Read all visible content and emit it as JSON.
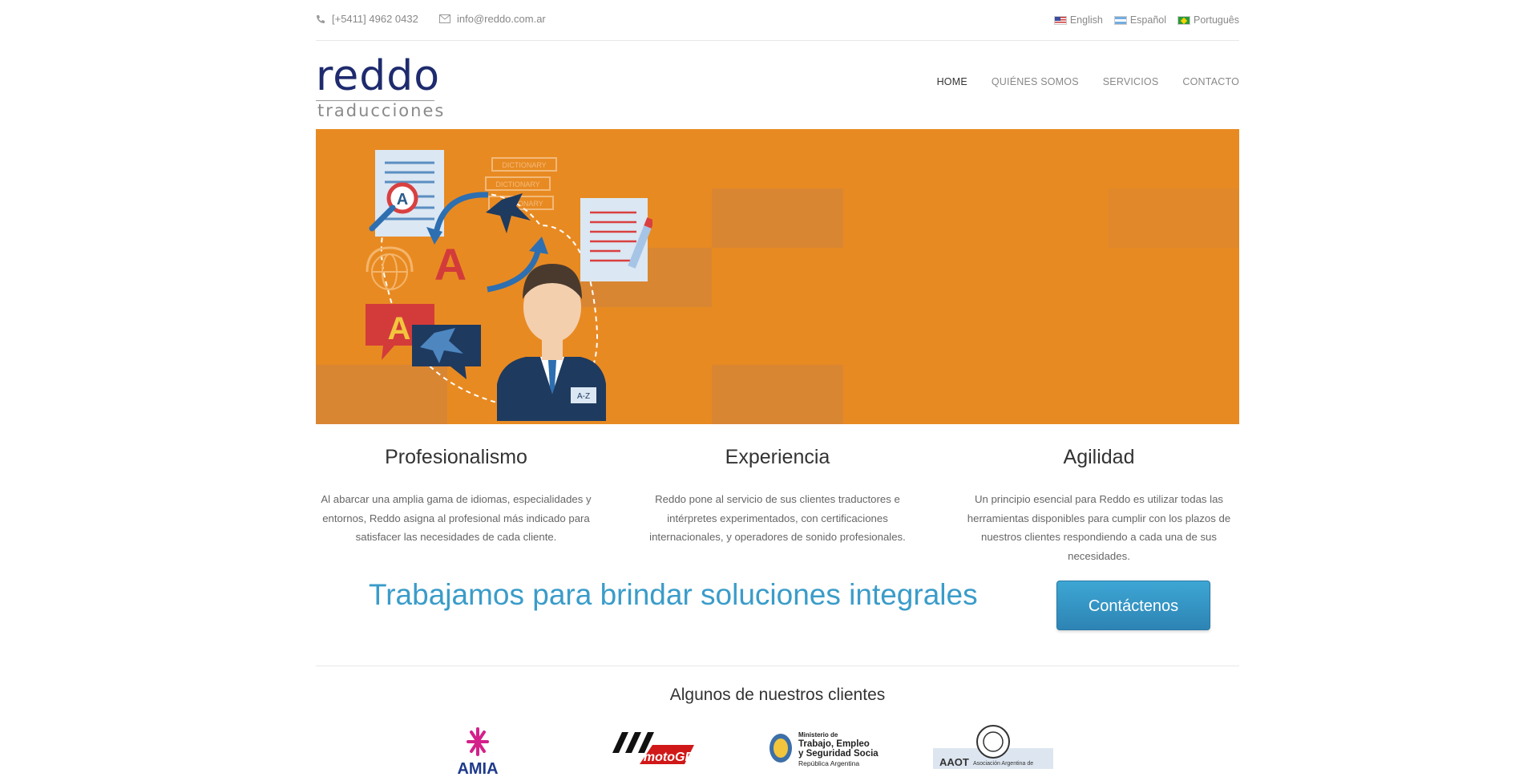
{
  "topbar": {
    "phone": "[+5411] 4962 0432",
    "email": "info@reddo.com.ar",
    "phone_icon": "phone-icon",
    "email_icon": "envelope-icon",
    "languages": [
      {
        "label": "English",
        "flag": "us-flag-icon"
      },
      {
        "label": "Español",
        "flag": "argentina-flag-icon"
      },
      {
        "label": "Português",
        "flag": "brazil-flag-icon"
      }
    ]
  },
  "logo": {
    "top": "reddo",
    "bottom": "traducciones"
  },
  "nav": {
    "items": [
      "HOME",
      "QUIÉNES SOMOS",
      "SERVICIOS",
      "CONTACTO"
    ],
    "active": "HOME"
  },
  "banner": {
    "background": "#e88a22",
    "doc_letter": "A",
    "bubble_letter": "A",
    "big_letter": "A",
    "badge": "A-Z",
    "dictionary_label": "DICTIONARY"
  },
  "features": [
    {
      "title": "Profesionalismo",
      "text": "Al abarcar una amplia gama de idiomas, especialidades y entornos, Reddo asigna al profesional más indicado para satisfacer las necesidades de cada cliente."
    },
    {
      "title": "Experiencia",
      "text": "Reddo pone al servicio de sus clientes traductores e intérpretes experimentados, con certificaciones internacionales, y operadores de sonido profesionales."
    },
    {
      "title": "Agilidad",
      "text": "Un principio esencial para Reddo es utilizar todas las herramientas disponibles para cumplir con los plazos de nuestros clientes respondiendo a cada una de sus necesidades."
    }
  ],
  "cta": {
    "text": "Trabajamos para brindar soluciones integrales",
    "button": "Contáctenos"
  },
  "clients": {
    "title": "Algunos de nuestros clientes",
    "logos": [
      {
        "name": "amia-logo",
        "text": "AMIA"
      },
      {
        "name": "motogp-logo",
        "text": "motoGP"
      },
      {
        "name": "ministerio-trabajo-logo",
        "lines": [
          "Ministerio de",
          "Trabajo, Empleo",
          "y Seguridad Social",
          "República Argentina"
        ]
      },
      {
        "name": "aaot-logo",
        "text": "AAOT",
        "sub": "Asociación Argentina de"
      }
    ]
  },
  "colors": {
    "accent": "#3a9cc9",
    "banner": "#e88a22",
    "logo": "#1e2b6e"
  }
}
